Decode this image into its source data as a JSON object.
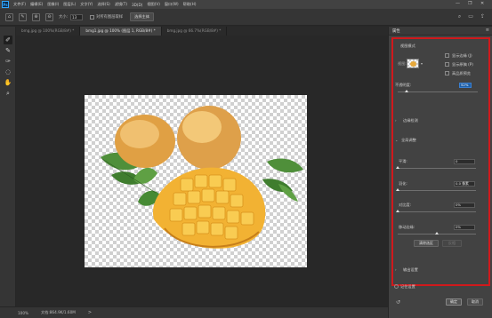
{
  "menubar": {
    "logo": "Ps",
    "items": [
      "文件(F)",
      "编辑(E)",
      "图像(I)",
      "图层(L)",
      "文字(Y)",
      "选择(S)",
      "滤镜(T)",
      "3D(D)",
      "视图(V)",
      "窗口(W)",
      "帮助(H)"
    ],
    "window_controls": [
      "—",
      "❐",
      "✕"
    ]
  },
  "optionsbar": {
    "size_label": "大小:",
    "size_value": "13",
    "sample_all_layers": "对所有图层取样",
    "select_subject": "选择主体"
  },
  "tabs": [
    {
      "label": "bmg.jpg @ 100%(RGB/8#) *",
      "active": false
    },
    {
      "label": "bmg1.jpg @ 100% (图层 1, RGB/8#) *",
      "active": true
    },
    {
      "label": "bmg.jpg @ 66.7%(RGB/8#) *",
      "active": false
    }
  ],
  "statusbar": {
    "zoom": "100%",
    "doc_info": "文档:864.9K/1.60M",
    "arrow": ">"
  },
  "panel": {
    "title": "属性",
    "view_mode_section": "视图模式",
    "view_label": "视图:",
    "show_edge": "显示边缘 (J)",
    "show_original": "显示原稿 (P)",
    "hq_preview": "高品质预览",
    "opacity_label": "不透明度:",
    "opacity_value": "52%",
    "edge_detection": "边缘检测",
    "global_refine": "全局调整",
    "smooth_label": "平滑:",
    "smooth_value": "0",
    "feather_label": "羽化:",
    "feather_value": "0.0 像素",
    "contrast_label": "对比度:",
    "contrast_value": "0%",
    "shift_edge_label": "移动边缘:",
    "shift_edge_value": "0%",
    "clear_selection": "清除选区",
    "invert": "反相",
    "output_settings": "输出设置",
    "remember_settings": "记住设置",
    "ok": "确定",
    "cancel": "取消"
  }
}
